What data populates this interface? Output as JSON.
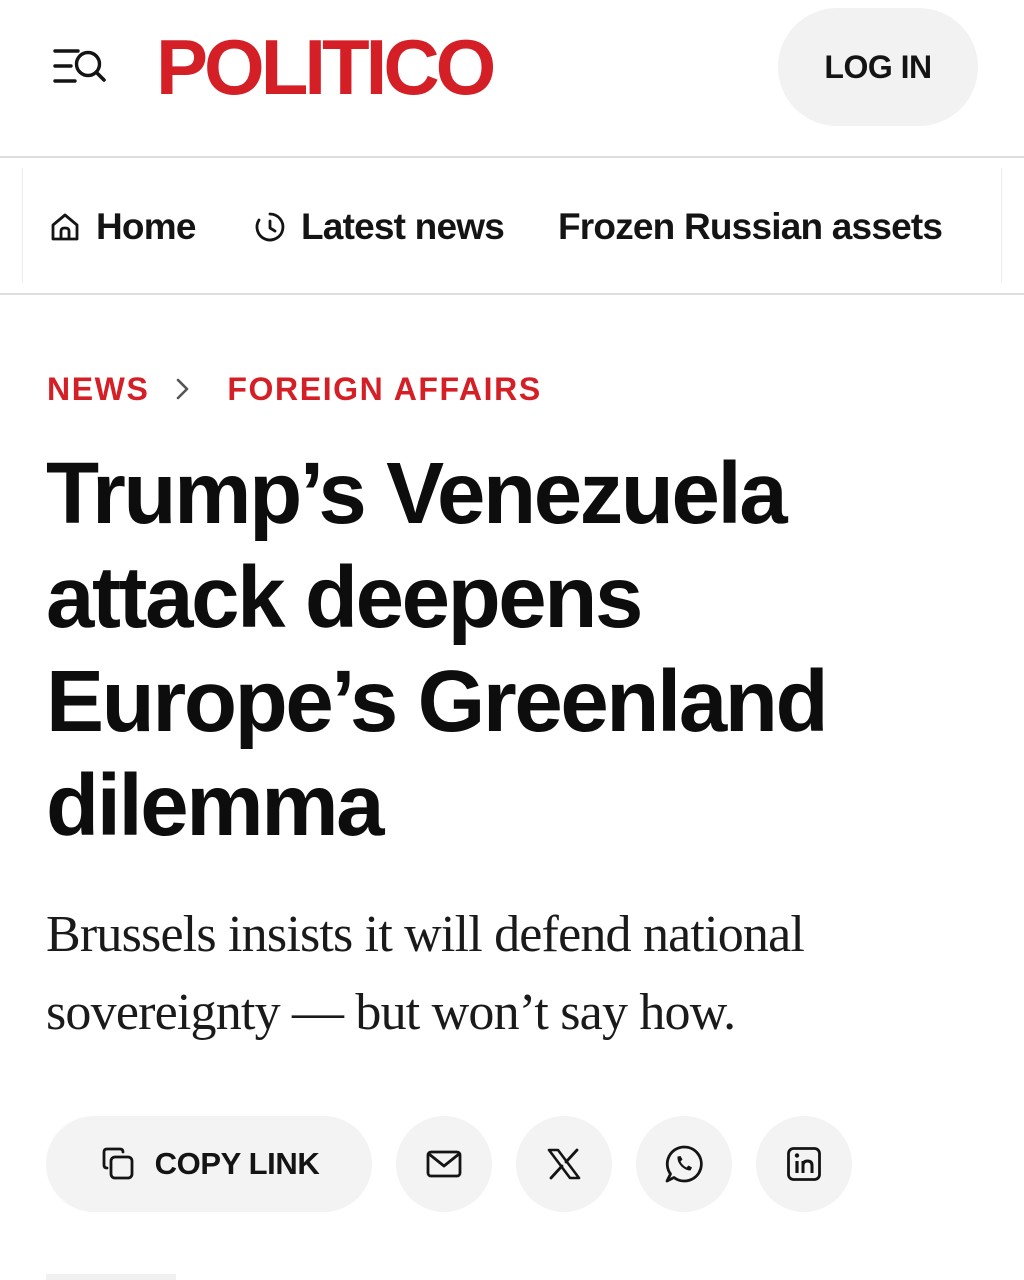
{
  "header": {
    "logo_text": "POLITICO",
    "menu_icon": "menu-search-icon",
    "login_label": "LOG IN"
  },
  "nav": {
    "items": [
      {
        "label": "Home",
        "icon": "home-icon"
      },
      {
        "label": "Latest news",
        "icon": "clock-icon"
      },
      {
        "label": "Frozen Russian assets"
      }
    ]
  },
  "breadcrumb": {
    "items": [
      {
        "label": "NEWS"
      },
      {
        "label": "FOREIGN AFFAIRS"
      }
    ]
  },
  "article": {
    "headline_lines": [
      "Trump’s Venezuela",
      "attack deepens",
      "Europe’s Greenland",
      "dilemma"
    ],
    "deck_lines": [
      "Brussels insists it will defend national",
      "sovereignty — but won’t say how."
    ]
  },
  "share": {
    "copy_link_label": "COPY LINK",
    "buttons": [
      "mail-icon",
      "x-logo-icon",
      "whatsapp-icon",
      "linkedin-icon"
    ]
  },
  "colors": {
    "brand_red": "#d51f26",
    "text": "#0d0d0d",
    "pill_bg": "#f3f3f3",
    "divider": "#dedede"
  }
}
